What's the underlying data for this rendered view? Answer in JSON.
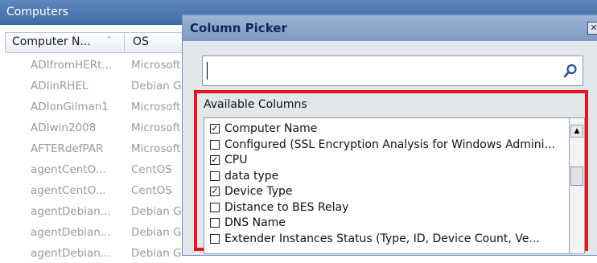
{
  "background_window": {
    "title": "Computers",
    "columns": [
      {
        "label": "Computer N..."
      },
      {
        "label": "OS"
      }
    ],
    "rows": [
      {
        "name": "ADIfromHERt...",
        "os": "Microsoft"
      },
      {
        "name": "ADIinRHEL",
        "os": "Debian G"
      },
      {
        "name": "ADIonGilman1",
        "os": "Microsoft"
      },
      {
        "name": "ADIwin2008",
        "os": "Microsoft"
      },
      {
        "name": "AFTERdefPAR",
        "os": "Microsoft"
      },
      {
        "name": "agentCentO...",
        "os": "CentOS"
      },
      {
        "name": "agentCentO...",
        "os": "CentOS"
      },
      {
        "name": "agentDebian...",
        "os": "Debian G"
      },
      {
        "name": "agentDebian...",
        "os": "Debian G"
      },
      {
        "name": "agentDebian...",
        "os": "Debian G"
      }
    ]
  },
  "dialog": {
    "title": "Column Picker",
    "close_glyph": "✕",
    "search": {
      "value": "",
      "placeholder": ""
    },
    "available_label": "Available Columns",
    "columns": [
      {
        "label": "Computer Name",
        "checked": true
      },
      {
        "label": "Configured (SSL Encryption Analysis for Windows Admini...",
        "checked": false
      },
      {
        "label": "CPU",
        "checked": true
      },
      {
        "label": "data type",
        "checked": false
      },
      {
        "label": "Device Type",
        "checked": true
      },
      {
        "label": "Distance to BES Relay",
        "checked": false
      },
      {
        "label": "DNS Name",
        "checked": false
      },
      {
        "label": "Extender Instances Status (Type, ID, Device Count, Ve...",
        "checked": false
      }
    ],
    "scroll_up_glyph": "▲"
  },
  "colors": {
    "highlight": "#e8161c",
    "titlebar": "#3f6aa6",
    "dialog_titlebar": "#7f9ac2"
  }
}
